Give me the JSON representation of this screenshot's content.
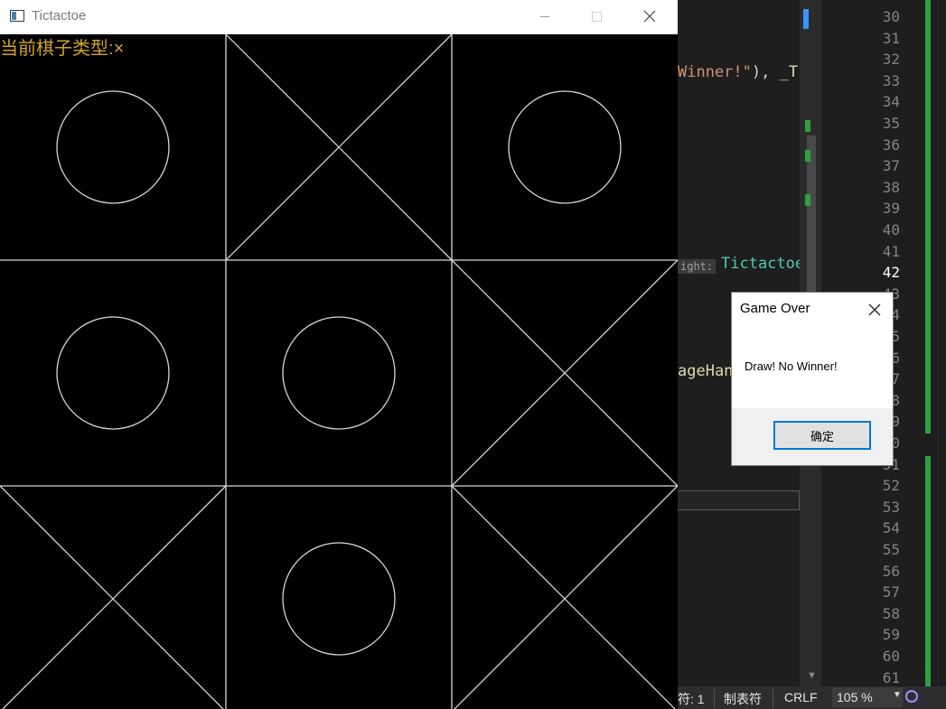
{
  "game_window": {
    "title": "Tictactoe",
    "piece_label": "当前棋子类型:",
    "current_piece": "×",
    "board": [
      [
        "O",
        "X",
        "O"
      ],
      [
        "O",
        "O",
        "X"
      ],
      [
        "X",
        "O",
        "X"
      ]
    ],
    "controls": [
      "minimize-icon",
      "maximize-icon",
      "close-icon"
    ]
  },
  "dialog": {
    "title": "Game Over",
    "message": "Draw! No Winner!",
    "ok_label": "确定"
  },
  "ide": {
    "code_line_1_string": "Winner!\"",
    "code_line_1_rest": "), ",
    "code_line_1_macro": "_T(",
    "param_hint": "ight:",
    "code_line_2": "Tictactoe",
    "code_line_3": "ageHan",
    "line_numbers": [
      "30",
      "31",
      "32",
      "33",
      "34",
      "35",
      "36",
      "37",
      "38",
      "39",
      "40",
      "41",
      "42",
      "43",
      "44",
      "45",
      "46",
      "47",
      "48",
      "49",
      "50",
      "51",
      "52",
      "53",
      "54",
      "55",
      "56",
      "57",
      "58",
      "59",
      "60",
      "61"
    ],
    "current_line": "42",
    "status": {
      "char": "符: 1",
      "indent": "制表符",
      "eol": "CRLF",
      "zoom": "105 %"
    }
  },
  "colors": {
    "piece_label": "#d2a22a",
    "board_lines": "#d8d8d8",
    "ide_bg": "#1e1e1e",
    "accent": "#0078d7"
  }
}
